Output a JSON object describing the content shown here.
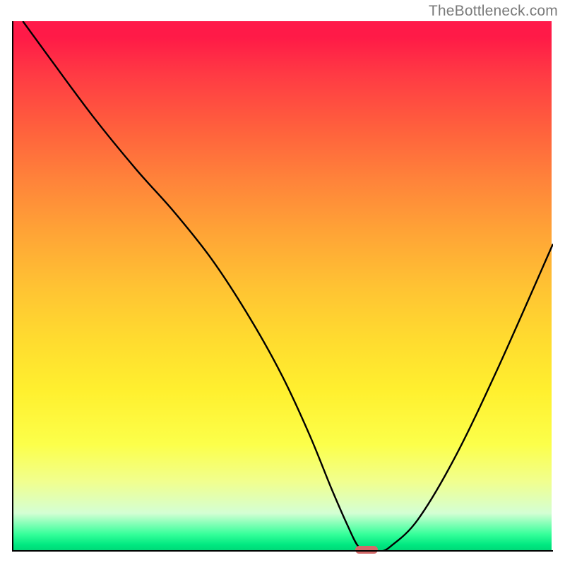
{
  "watermark": "TheBottleneck.com",
  "chart_data": {
    "type": "line",
    "title": "",
    "xlabel": "",
    "ylabel": "",
    "xlim": [
      0,
      100
    ],
    "ylim": [
      0,
      100
    ],
    "background_gradient": {
      "top": "#ff1a4a",
      "upper_mid": "#ffa436",
      "mid": "#ffdb2f",
      "lower_mid": "#fcff4a",
      "bottom": "#00d878"
    },
    "series": [
      {
        "name": "bottleneck-curve",
        "x": [
          2,
          7,
          15,
          23,
          30,
          37,
          44,
          50,
          55,
          59,
          62,
          64,
          66,
          68,
          70,
          75,
          82,
          90,
          100
        ],
        "values": [
          100,
          93,
          82,
          72,
          64,
          55,
          44,
          33,
          22,
          12,
          5,
          1,
          0,
          0,
          1,
          6,
          18,
          35,
          58
        ]
      }
    ],
    "marker": {
      "x": 65.5,
      "y": 0.3,
      "width": 4.2,
      "height": 1.4,
      "color": "#d46a6a"
    }
  }
}
